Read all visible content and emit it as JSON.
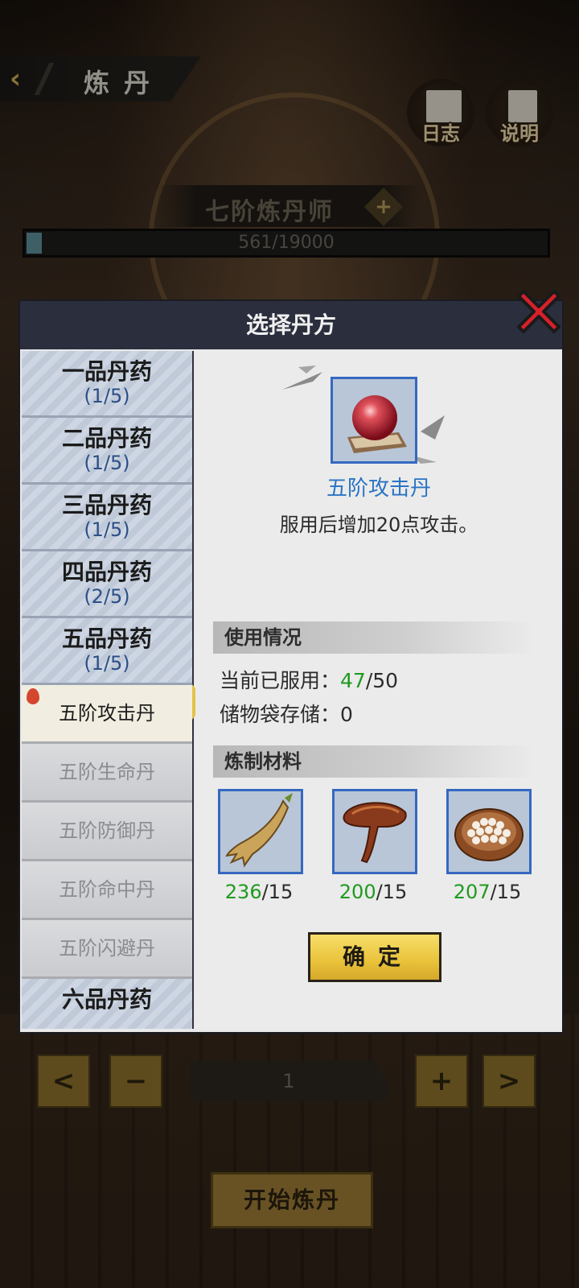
{
  "header": {
    "title": "炼丹",
    "log_label": "日志",
    "help_label": "说明"
  },
  "rank": {
    "title": "七阶炼丹师",
    "exp_text": "561/19000",
    "exp_current": 561,
    "exp_max": 19000
  },
  "modal": {
    "title": "选择丹方",
    "categories": [
      {
        "name": "一品丹药",
        "count": "(1/5)"
      },
      {
        "name": "二品丹药",
        "count": "(1/5)"
      },
      {
        "name": "三品丹药",
        "count": "(1/5)"
      },
      {
        "name": "四品丹药",
        "count": "(2/5)"
      },
      {
        "name": "五品丹药",
        "count": "(1/5)"
      }
    ],
    "recipes": [
      {
        "name": "五阶攻击丹",
        "active": true
      },
      {
        "name": "五阶生命丹",
        "active": false
      },
      {
        "name": "五阶防御丹",
        "active": false
      },
      {
        "name": "五阶命中丹",
        "active": false
      },
      {
        "name": "五阶闪避丹",
        "active": false
      }
    ],
    "next_category": "六品丹药",
    "item": {
      "name": "五阶攻击丹",
      "description": "服用后增加20点攻击。"
    },
    "usage": {
      "header": "使用情况",
      "consumed_label": "当前已服用：",
      "consumed_value": "47",
      "consumed_max": "/50",
      "storage_label": "储物袋存储：",
      "storage_value": "0"
    },
    "materials": {
      "header": "炼制材料",
      "items": [
        {
          "icon": "ginseng-icon",
          "have": "236",
          "need": "/15"
        },
        {
          "icon": "lingzhi-icon",
          "have": "200",
          "need": "/15"
        },
        {
          "icon": "pearl-bowl-icon",
          "have": "207",
          "need": "/15"
        }
      ]
    },
    "confirm_label": "确定"
  },
  "controls": {
    "prev": "<",
    "minus": "−",
    "quantity": "1",
    "plus": "+",
    "next": ">",
    "start_label": "开始炼丹"
  },
  "colors": {
    "accent_gold": "#e9c23a",
    "item_name_blue": "#2a74c4",
    "have_green": "#1f9a1f",
    "close_red": "#d8202a"
  }
}
